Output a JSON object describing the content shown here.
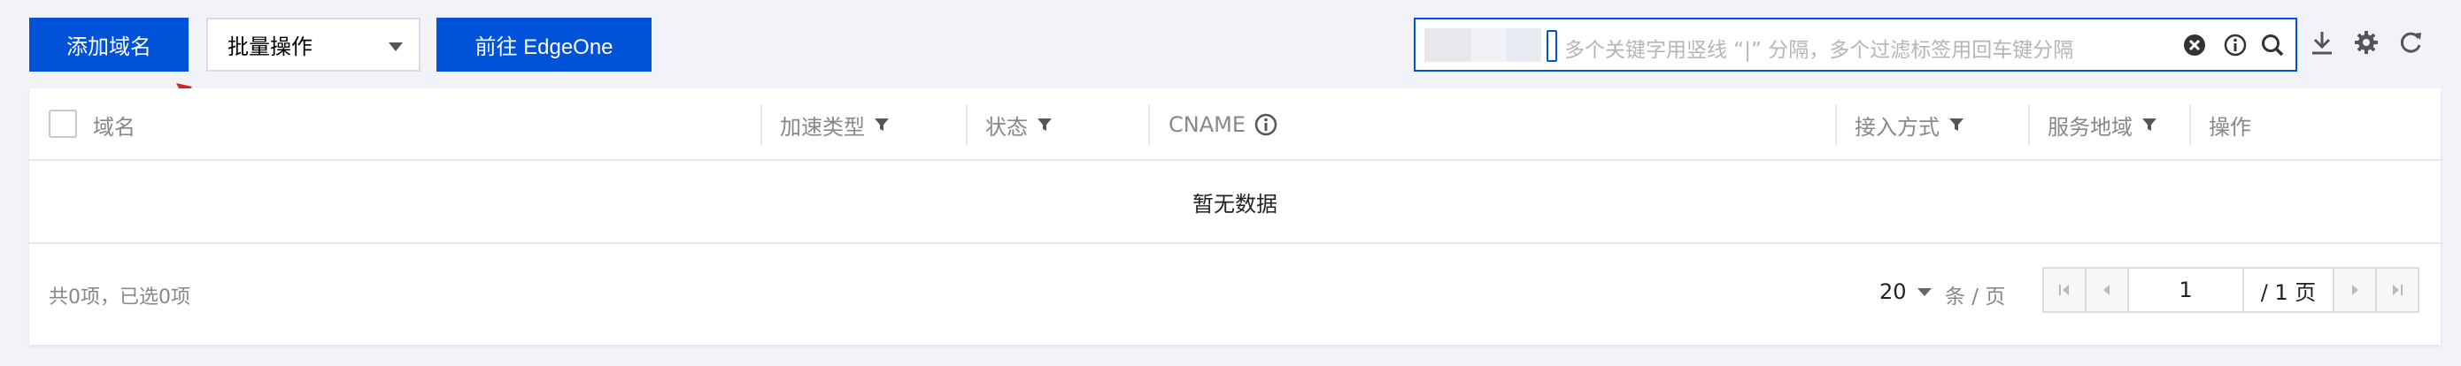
{
  "toolbar": {
    "add_domain_label": "添加域名",
    "bulk_select_value": "批量操作",
    "edgeone_label": "前往 EdgeOne"
  },
  "search": {
    "placeholder": "多个关键字用竖线 “|” 分隔，多个过滤标签用回车键分隔"
  },
  "table": {
    "columns": [
      {
        "label": "域名",
        "filter": false
      },
      {
        "label": "加速类型",
        "filter": true
      },
      {
        "label": "状态",
        "filter": true
      },
      {
        "label": "CNAME",
        "info": true
      },
      {
        "label": "接入方式",
        "filter": true
      },
      {
        "label": "服务地域",
        "filter": true
      },
      {
        "label": "操作",
        "filter": false
      }
    ],
    "empty_text": "暂无数据"
  },
  "footer": {
    "summary": "共0项，已选0项",
    "page_size": "20",
    "per_page_label": "条 / 页",
    "current_page": "1",
    "total_pages": "/ 1 页"
  },
  "colors": {
    "primary": "#0052d9",
    "annotation": "#e02020"
  },
  "icons": [
    "clear-icon",
    "info-icon",
    "search-icon",
    "download-icon",
    "settings-icon",
    "refresh-icon",
    "filter-icon",
    "first-page-icon",
    "prev-page-icon",
    "next-page-icon",
    "last-page-icon"
  ]
}
